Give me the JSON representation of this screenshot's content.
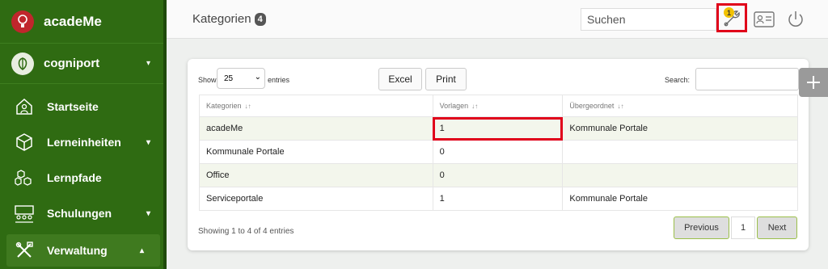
{
  "sidebar": {
    "brand": "acadeMe",
    "org": "cogniport",
    "items": [
      {
        "label": "Startseite"
      },
      {
        "label": "Lerneinheiten"
      },
      {
        "label": "Lernpfade"
      },
      {
        "label": "Schulungen"
      },
      {
        "label": "Verwaltung"
      }
    ]
  },
  "header": {
    "title": "Kategorien",
    "count": "4",
    "search_placeholder": "Suchen",
    "notification_count": "1"
  },
  "table_controls": {
    "show_label": "Show",
    "page_size": "25",
    "entries_label": "entries",
    "excel_label": "Excel",
    "print_label": "Print",
    "search_label": "Search:"
  },
  "table": {
    "columns": [
      "Kategorien",
      "Vorlagen",
      "Übergeordnet"
    ],
    "rows": [
      [
        "acadeMe",
        "1",
        "Kommunale Portale"
      ],
      [
        "Kommunale Portale",
        "0",
        ""
      ],
      [
        "Office",
        "0",
        ""
      ],
      [
        "Serviceportale",
        "1",
        "Kommunale Portale"
      ]
    ]
  },
  "footer": {
    "info": "Showing 1 to 4 of 4 entries",
    "previous": "Previous",
    "page": "1",
    "next": "Next"
  },
  "colors": {
    "sidebar": "#2f6b12",
    "highlight": "#e0001a",
    "row_stripe": "#f3f6ec"
  }
}
